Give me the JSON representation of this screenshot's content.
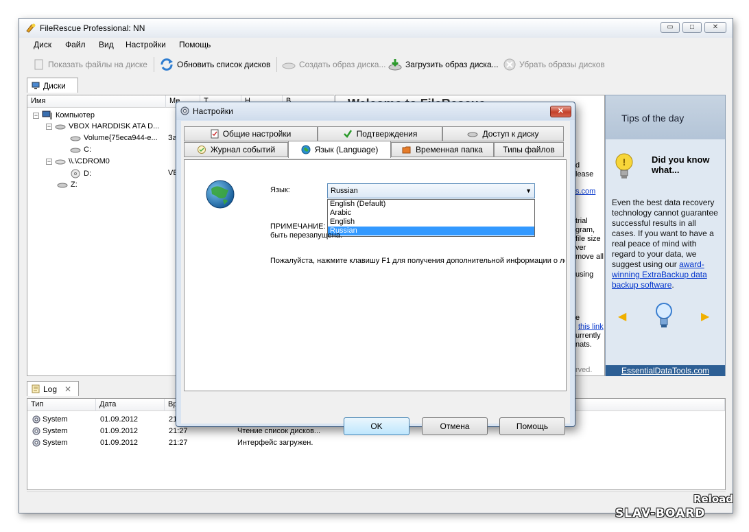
{
  "window": {
    "title": "FileRescue Professional: NN",
    "minimize": "▭",
    "maximize": "□",
    "close": "✕"
  },
  "menu": [
    "Диск",
    "Файл",
    "Вид",
    "Настройки",
    "Помощь"
  ],
  "toolbar": {
    "show_files": "Показать файлы на диске",
    "refresh": "Обновить список дисков",
    "create_image": "Создать образ диска...",
    "load_image": "Загрузить образ диска...",
    "remove_images": "Убрать образы дисков"
  },
  "disks_tab": {
    "label": "Диски"
  },
  "tree": {
    "columns": [
      "Имя",
      "Ме",
      "Т",
      "Н",
      "В"
    ],
    "rows": [
      {
        "label": "Компьютер",
        "extra": ""
      },
      {
        "label": "VBOX HARDDISK ATA D...",
        "extra": ""
      },
      {
        "label": "Volume{75eca944-e...",
        "extra": "За"
      },
      {
        "label": "C:",
        "extra": ""
      },
      {
        "label": "\\\\.\\CDROM0",
        "extra": ""
      },
      {
        "label": "D:",
        "extra": "VE"
      },
      {
        "label": "Z:",
        "extra": ""
      }
    ]
  },
  "welcome": {
    "heading": "Welcome to FileRescue",
    "fragments": [
      "d",
      "lease",
      "s.com",
      "trial",
      "gram,",
      "file size",
      "ver",
      "move all",
      "using",
      "e",
      "this link",
      "urrently",
      "nats.",
      "rved."
    ]
  },
  "tips": {
    "title": "Tips of the day",
    "did_you_know": "Did you know what...",
    "body_prefix": "Even the best data recovery technology cannot guarantee successful results in all cases. If you want to have a real peace of mind with regard to your data, we suggest using our ",
    "body_link": "award-winning ExtraBackup data backup software",
    "body_suffix": ".",
    "prev": "◀",
    "next": "▶",
    "footer": "EssentialDataTools.com"
  },
  "log_tab": {
    "label": "Log",
    "close": "✕"
  },
  "log": {
    "columns": [
      "Тип",
      "Дата",
      "Вр",
      ""
    ],
    "rows": [
      {
        "type": "System",
        "date": "01.09.2012",
        "time": "21",
        "message": ""
      },
      {
        "type": "System",
        "date": "01.09.2012",
        "time": "21:27",
        "message": "Чтение список дисков..."
      },
      {
        "type": "System",
        "date": "01.09.2012",
        "time": "21:27",
        "message": "Интерфейс загружен."
      }
    ]
  },
  "dialog": {
    "title": "Настройки",
    "close": "✕",
    "tabs_row1": [
      "Общие настройки",
      "Подтверждения",
      "Доступ к диску"
    ],
    "tabs_row2": [
      "Журнал событий",
      "Язык (Language)",
      "Временная папка",
      "Типы файлов"
    ],
    "language_label": "Язык:",
    "selected_language": "Russian",
    "language_options": [
      "English (Default)",
      "Arabic",
      "English",
      "Russian"
    ],
    "note_line1": "ПРИМЕЧАНИЕ:",
    "note_line2": "быть перезапущена.",
    "help_text": "Пожалуйста, нажмите клавишу F1 для получения дополнительной информации о ло",
    "ok": "OK",
    "cancel": "Отмена",
    "help": "Помощь"
  },
  "watermark": {
    "top": "Reload",
    "bottom": "SLAV-BOARD"
  },
  "colors": {
    "accent": "#3399ff",
    "tips_footer": "#2d5f95",
    "link": "#0033cc"
  }
}
